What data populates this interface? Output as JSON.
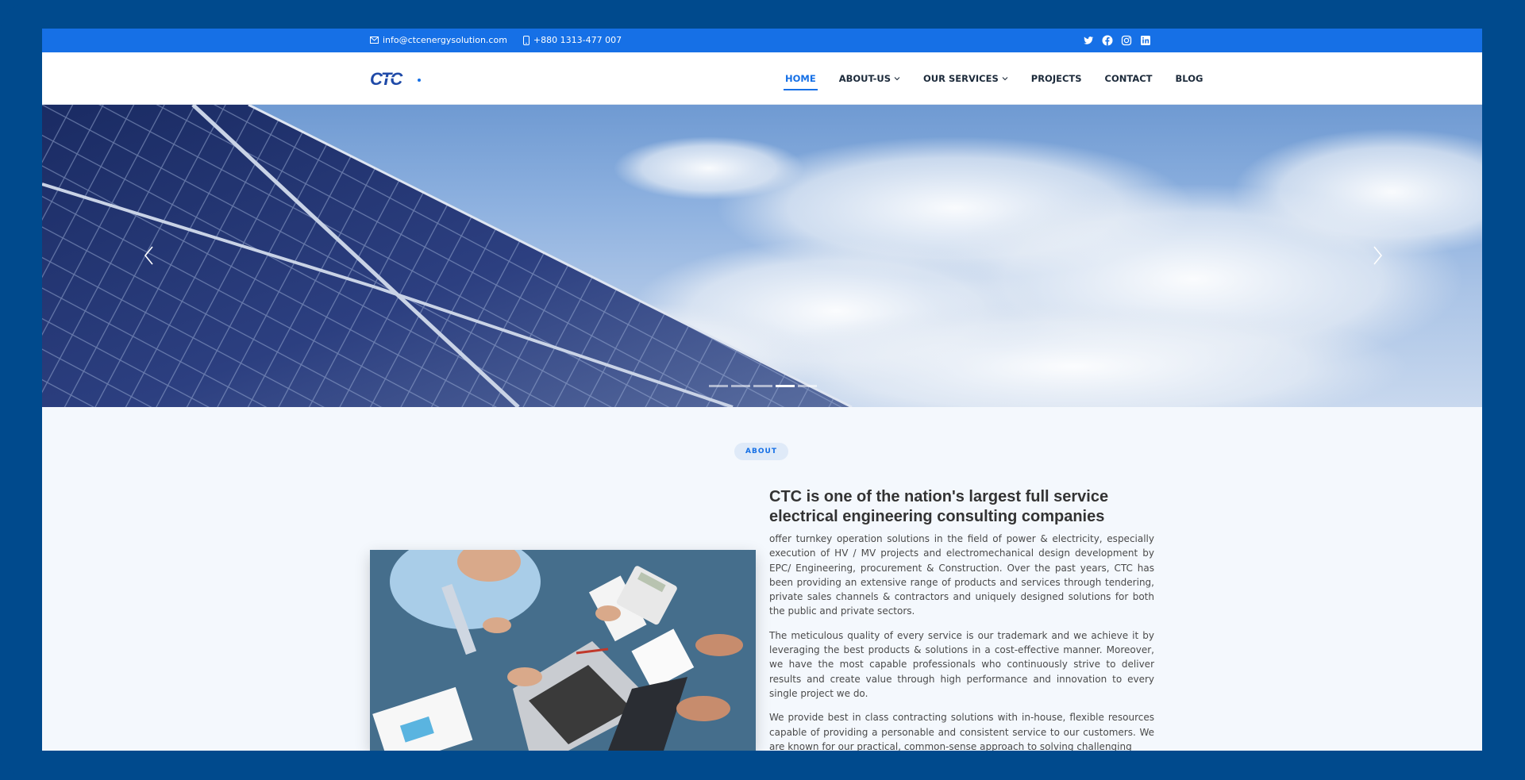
{
  "topbar": {
    "email": "info@ctcenergysolution.com",
    "phone": "+880 1313-477 007",
    "social_icons": [
      "twitter-icon",
      "facebook-icon",
      "instagram-icon",
      "linkedin-icon"
    ]
  },
  "header": {
    "logo_text": "CTC",
    "nav": [
      {
        "label": "HOME",
        "active": true,
        "dropdown": false
      },
      {
        "label": "ABOUT-US",
        "active": false,
        "dropdown": true
      },
      {
        "label": "OUR SERVICES",
        "active": false,
        "dropdown": true
      },
      {
        "label": "PROJECTS",
        "active": false,
        "dropdown": false
      },
      {
        "label": "CONTACT",
        "active": false,
        "dropdown": false
      },
      {
        "label": "BLOG",
        "active": false,
        "dropdown": false
      }
    ]
  },
  "hero": {
    "slide_count": 5,
    "active_slide": 4
  },
  "about": {
    "badge": "ABOUT",
    "heading": "CTC is one of the nation's largest full service electrical engineering consulting companies",
    "paragraphs": [
      "offer turnkey operation solutions in the field of power & electricity, especially execution of HV / MV projects and electromechanical design development by EPC/ Engineering, procurement & Construction. Over the past years, CTC has been providing an extensive range of products and services through tendering, private sales channels & contractors and uniquely designed solutions for both the public and private sectors.",
      "The meticulous quality of every service is our trademark and we achieve it by leveraging the best products & solutions in a cost-effective manner. Moreover, we have the most capable professionals who continuously strive to deliver results and create value through high performance and innovation to every single project we do.",
      "We provide best in class contracting solutions with in-house, flexible resources capable of providing a personable and consistent service to our customers. We are known for our practical, common-sense approach to solving challenging"
    ]
  },
  "colors": {
    "frame": "#004a8d",
    "primary": "#1670e6",
    "background": "#f4f8fd"
  }
}
